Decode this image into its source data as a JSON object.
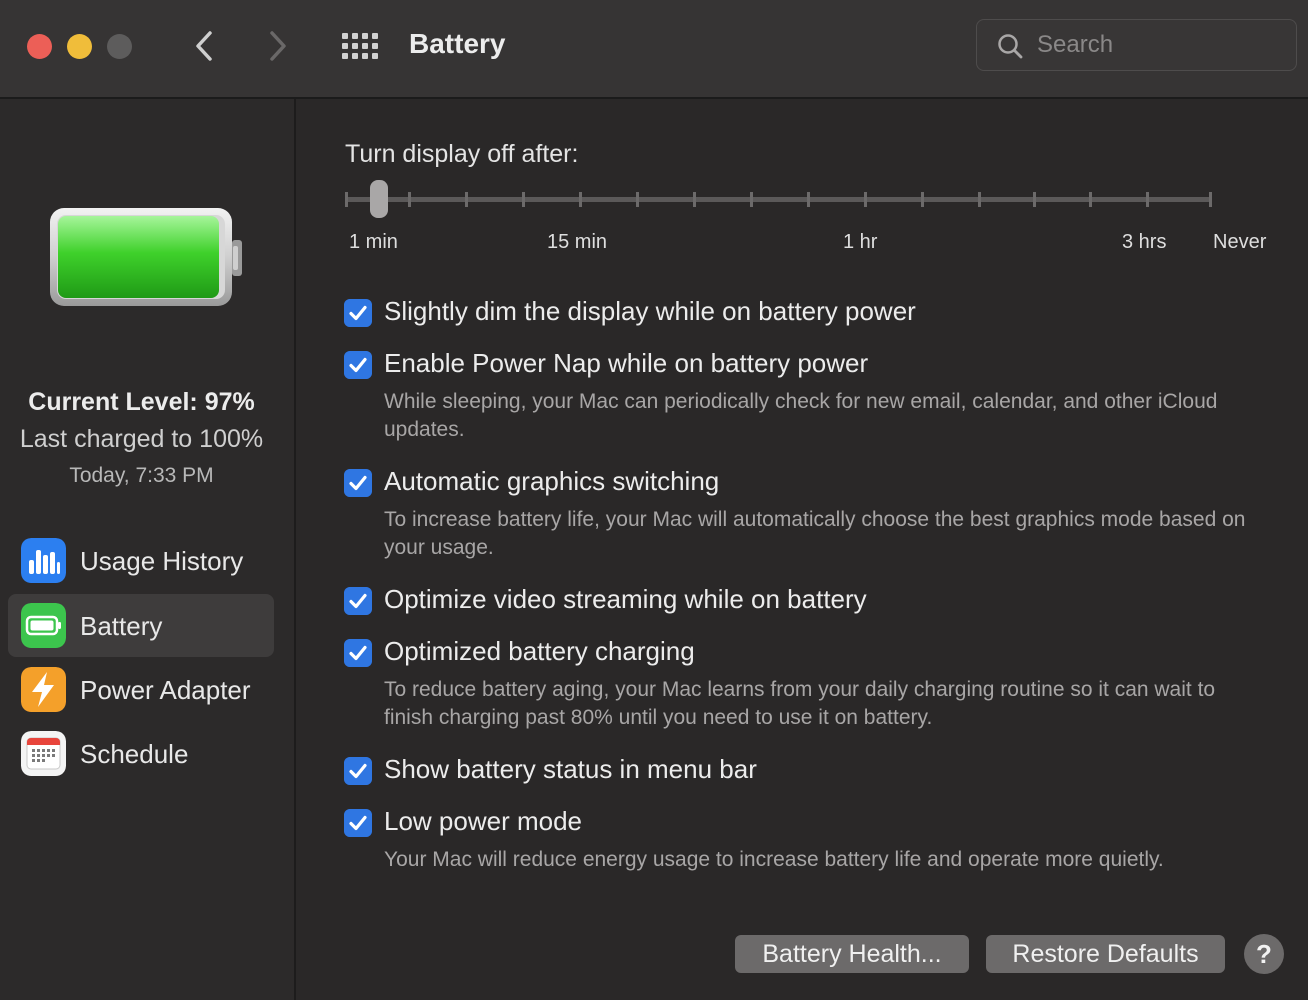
{
  "window": {
    "title": "Battery"
  },
  "search": {
    "placeholder": "Search"
  },
  "sidebar": {
    "current_level": "Current Level: 97%",
    "last_charged": "Last charged to 100%",
    "charged_time": "Today, 7:33 PM",
    "battery_level": 0.97,
    "items": [
      {
        "label": "Usage History",
        "icon": "bar-chart-icon",
        "selected": false
      },
      {
        "label": "Battery",
        "icon": "battery-icon",
        "selected": true
      },
      {
        "label": "Power Adapter",
        "icon": "lightning-icon",
        "selected": false
      },
      {
        "label": "Schedule",
        "icon": "calendar-icon",
        "selected": false
      }
    ]
  },
  "display_slider": {
    "title": "Turn display off after:",
    "tick_labels": [
      "1 min",
      "15 min",
      "1 hr",
      "3 hrs",
      "Never"
    ],
    "value": "2 min"
  },
  "options": [
    {
      "label": "Slightly dim the display while on battery power",
      "checked": true,
      "description": ""
    },
    {
      "label": "Enable Power Nap while on battery power",
      "checked": true,
      "description": "While sleeping, your Mac can periodically check for new email, calendar, and other iCloud updates."
    },
    {
      "label": "Automatic graphics switching",
      "checked": true,
      "description": "To increase battery life, your Mac will automatically choose the best graphics mode based on your usage."
    },
    {
      "label": "Optimize video streaming while on battery",
      "checked": true,
      "description": ""
    },
    {
      "label": "Optimized battery charging",
      "checked": true,
      "description": "To reduce battery aging, your Mac learns from your daily charging routine so it can wait to finish charging past 80% until you need to use it on battery."
    },
    {
      "label": "Show battery status in menu bar",
      "checked": true,
      "description": ""
    },
    {
      "label": "Low power mode",
      "checked": true,
      "description": "Your Mac will reduce energy usage to increase battery life and operate more quietly."
    }
  ],
  "buttons": {
    "battery_health": "Battery Health...",
    "restore_defaults": "Restore Defaults",
    "help": "?"
  },
  "colors": {
    "checkbox": "#2f76e2",
    "battery_fill": "#3fd12b",
    "window_bg": "#2a2828"
  }
}
